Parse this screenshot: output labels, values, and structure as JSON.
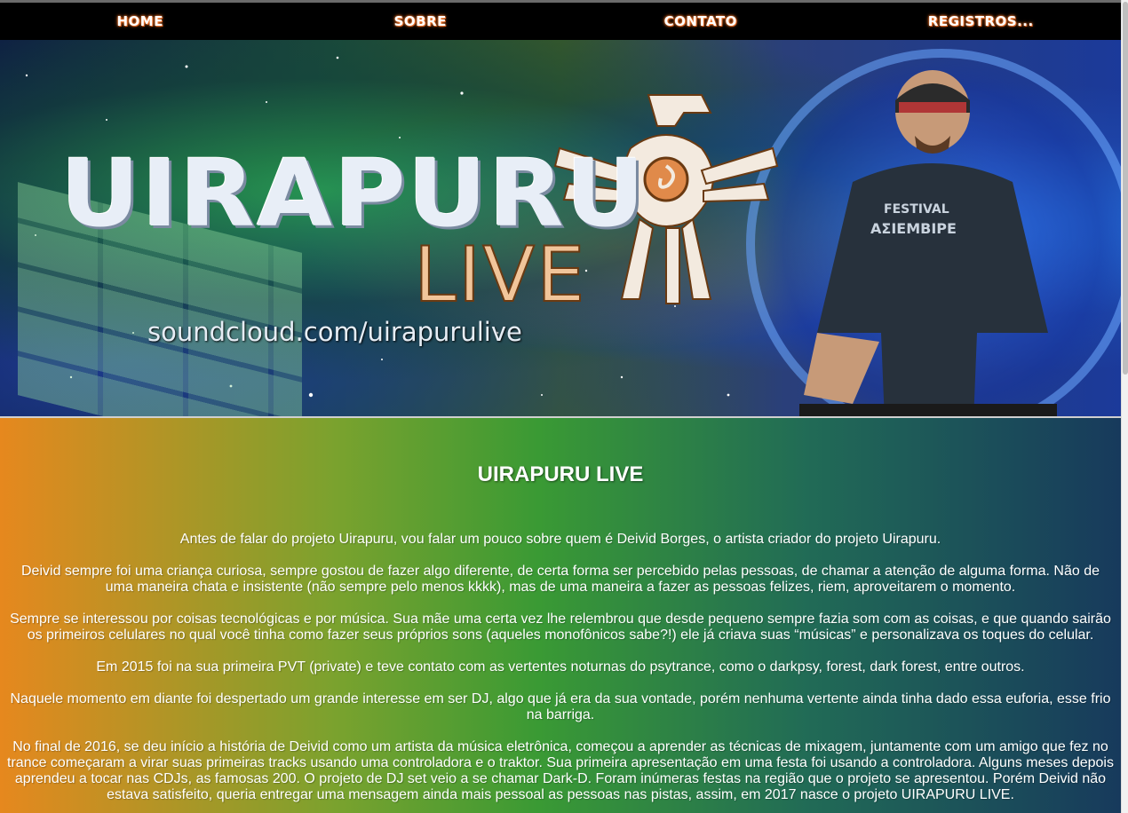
{
  "nav": {
    "items": [
      "HOME",
      "SOBRE",
      "CONTATO",
      "REGISTROS..."
    ]
  },
  "banner": {
    "title": "UIRAPURU",
    "subtitle": "LIVE",
    "url": "soundcloud.com/uirapurulive"
  },
  "main": {
    "heading": "UIRAPURU LIVE",
    "paragraphs": [
      "Antes de falar do projeto Uirapuru, vou falar um pouco sobre quem é Deivid Borges, o artista criador do projeto Uirapuru.",
      "Deivid sempre foi uma criança curiosa, sempre gostou de fazer algo diferente, de certa forma ser percebido pelas pessoas, de chamar a atenção de alguma forma. Não de uma maneira chata e insistente (não sempre pelo menos kkkk), mas de uma maneira a fazer as pessoas felizes, riem, aproveitarem o momento.",
      "Sempre se interessou por coisas tecnológicas e por música. Sua mãe uma certa vez lhe relembrou que desde pequeno sempre fazia som com as coisas, e que quando sairão os primeiros celulares no qual você tinha como fazer seus próprios sons (aqueles monofônicos sabe?!) ele já criava suas “músicas” e personalizava os toques do celular.",
      "Em 2015 foi na sua primeira PVT (private) e teve contato com as vertentes noturnas do psytrance, como o darkpsy, forest, dark forest, entre outros.",
      "Naquele momento em diante foi despertado um grande interesse em ser DJ, algo que já era da sua vontade, porém nenhuma vertente ainda tinha dado essa euforia, esse frio na barriga.",
      "No final de 2016, se deu início a história de Deivid como um artista da música eletrônica, começou a aprender as técnicas de mixagem, juntamente com um amigo que fez no trance começaram a virar suas primeiras tracks usando uma controladora e o traktor. Sua primeira apresentação em uma festa foi usando a controladora. Alguns meses depois aprendeu a tocar nas CDJs, as famosas 200. O projeto de DJ set veio a se chamar Dark-D. Foram inúmeras festas na região que o projeto se apresentou. Porém Deivid não estava satisfeito, queria entregar uma mensagem ainda mais pessoal as pessoas nas pistas, assim, em 2017 nasce o projeto UIRAPURU LIVE."
    ]
  },
  "colors": {
    "nav_bg": "#000000",
    "nav_glow": "#ff6a1a",
    "gradient_left": "#e6881e",
    "gradient_mid": "#3a9a34",
    "gradient_right": "#173a5c"
  }
}
